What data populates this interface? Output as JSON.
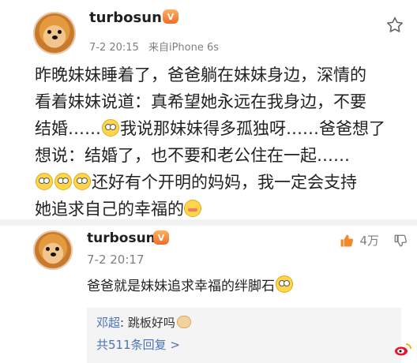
{
  "post": {
    "username": "turbosun",
    "vip_label": "V",
    "date": "7-2 20:15",
    "source": "来自iPhone 6s",
    "content_line1": "昨晚妹妹睡着了，爸爸躺在妹妹身边，深情的",
    "content_line2": "看着妹妹说道：真希望她永远在我身边，不要",
    "content_line3a": "结婚……",
    "content_line3b": "我说那妹妹得多孤独呀……爸爸想了",
    "content_line4": "想说：结婚了，也不要和老公住在一起……",
    "content_line5": "还好有个开明的妈妈，我一定会支持",
    "content_line6": "她追求自己的幸福的"
  },
  "comment": {
    "username": "turbosun",
    "vip_label": "V",
    "date": "7-2 20:17",
    "text": "爸爸就是妹妹追求幸福的绊脚石",
    "likes": "4万"
  },
  "sub_reply": {
    "name": "邓超",
    "text": "跳板好吗",
    "more": "共511条回复 >"
  },
  "colors": {
    "link_blue": "#4b73b7",
    "meta_gray": "#7f7f7f",
    "accent_orange": "#f06b2a",
    "background": "#ffffff"
  },
  "icons": {
    "favorite": "star-icon",
    "like": "thumb-up-icon",
    "dislike": "thumb-down-icon",
    "brand": "weibo-icon"
  }
}
